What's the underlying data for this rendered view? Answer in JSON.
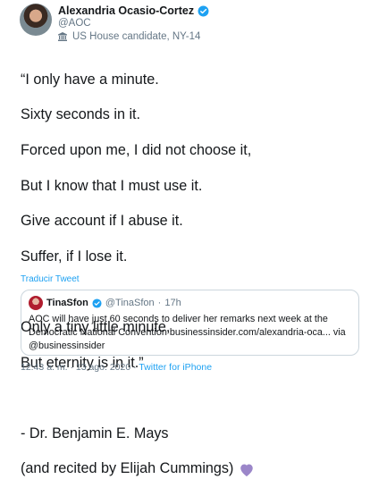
{
  "author": {
    "name": "Alexandria Ocasio-Cortez",
    "handle": "@AOC",
    "label": "US House candidate, NY-14"
  },
  "tweet": {
    "lines": [
      "“I only have a minute.",
      "Sixty seconds in it.",
      "Forced upon me, I did not choose it,",
      "But I know that I must use it.",
      "Give account if I abuse it.",
      "Suffer, if I lose it.",
      "",
      "Only a tiny little minute,",
      "But eternity is in it.”",
      "",
      "- Dr. Benjamin E. Mays"
    ],
    "last_line": "(and recited by Elijah Cummings)",
    "heart_color": "#9b86c9",
    "translate_label": "Traducir Tweet"
  },
  "quoted": {
    "name": "TinaSfon",
    "handle": "@TinaSfon",
    "separator": "·",
    "age": "17h",
    "text": "AOC will have just 60 seconds to deliver her remarks next week at the Democratic National Convention businessinsider.com/alexandria-oca... via @businessinsider"
  },
  "footer": {
    "time": "12:43 a. m.",
    "sep1": "·",
    "date": "13 ago. 2020",
    "sep2": "·",
    "app": "Twitter for iPhone"
  },
  "colors": {
    "link": "#1da1f2",
    "muted": "#657786",
    "verified": "#1da1f2"
  }
}
